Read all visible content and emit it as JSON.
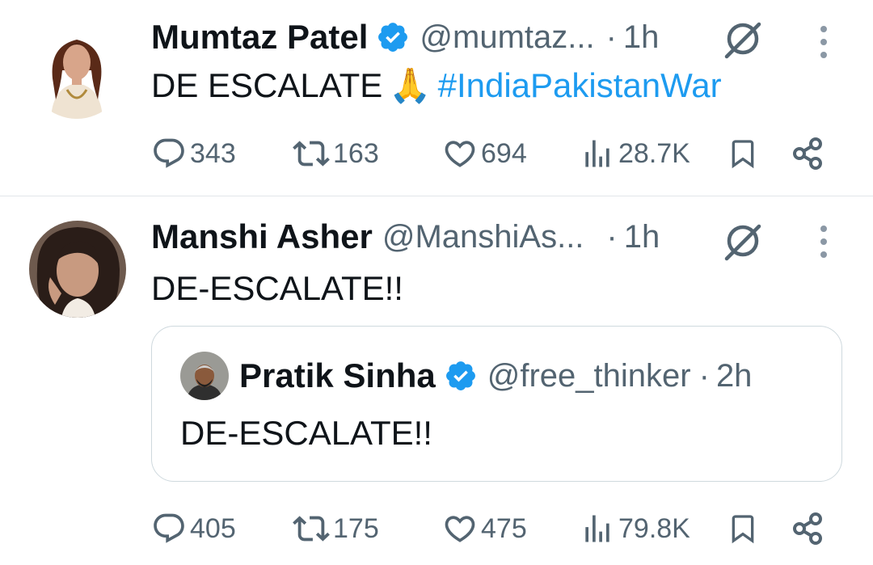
{
  "tweets": [
    {
      "author_name": "Mumtaz Patel",
      "verified": true,
      "handle": "@mumtaz...",
      "separator": "·",
      "time": "1h",
      "text_main": "DE ESCALATE",
      "emoji": "🙏",
      "hashtag": "#IndiaPakistanWar",
      "stats": {
        "replies": "343",
        "reposts": "163",
        "likes": "694",
        "views": "28.7K"
      }
    },
    {
      "author_name": "Manshi Asher",
      "verified": false,
      "handle": "@ManshiAs...",
      "separator": "·",
      "time": "1h",
      "text_main": "DE-ESCALATE!!",
      "quote": {
        "author_name": "Pratik Sinha",
        "verified": true,
        "handle": "@free_thinker",
        "separator": "·",
        "time": "2h",
        "text": "DE-ESCALATE!!"
      },
      "stats": {
        "replies": "405",
        "reposts": "175",
        "likes": "475",
        "views": "79.8K"
      }
    }
  ],
  "icons": {
    "reply": "reply-icon",
    "repost": "repost-icon",
    "like": "heart-icon",
    "views": "views-icon",
    "bookmark": "bookmark-icon",
    "share": "share-icon",
    "grok": "grok-icon",
    "more": "more-icon",
    "verified": "verified-badge-icon"
  },
  "colors": {
    "text": "#0f1419",
    "secondary": "#536471",
    "link": "#1d9bf0",
    "verified": "#1d9bf0",
    "divider": "#e1e6ea"
  }
}
